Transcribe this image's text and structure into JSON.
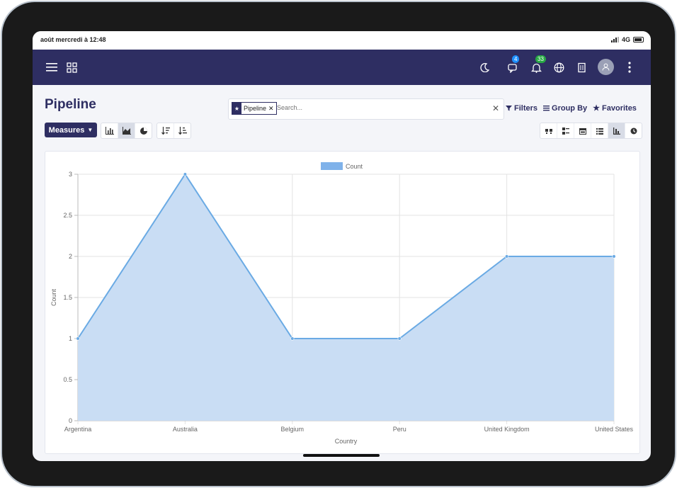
{
  "status_bar": {
    "time": "août mercredi à 12:48",
    "network": "4G"
  },
  "navbar": {
    "activities_badge": "4",
    "notifications_badge": "33",
    "accent_color": "#2e2e62",
    "activity_badge_color": "#1e90ff",
    "notification_badge_color": "#27a844"
  },
  "page": {
    "title": "Pipeline"
  },
  "search": {
    "facet_label": "Pipeline",
    "placeholder": "Search..."
  },
  "search_options": {
    "filters": "Filters",
    "group_by": "Group By",
    "favorites": "Favorites"
  },
  "toolbar": {
    "measures_label": "Measures",
    "chart_types": [
      "bar-chart-icon",
      "line-chart-icon",
      "pie-chart-icon"
    ],
    "active_chart_type": "line-chart-icon"
  },
  "views": {
    "items": [
      "kanban-icon",
      "list-icon",
      "calendar-icon",
      "pivot-icon",
      "graph-icon",
      "activity-icon"
    ],
    "active": "graph-icon"
  },
  "chart_data": {
    "type": "area",
    "categories": [
      "Argentina",
      "Australia",
      "Belgium",
      "Peru",
      "United Kingdom",
      "United States"
    ],
    "series": [
      {
        "name": "Count",
        "values": [
          1,
          3,
          1,
          1,
          2,
          2
        ]
      }
    ],
    "xlabel": "Country",
    "ylabel": "Count",
    "ylim": [
      0,
      3
    ],
    "yticks": [
      "0",
      "0.5",
      "1",
      "1.5",
      "2",
      "2.5",
      "3"
    ],
    "legend": "top",
    "grid": true,
    "line_color": "#6aaae4",
    "fill_color": "#c9ddf4"
  }
}
